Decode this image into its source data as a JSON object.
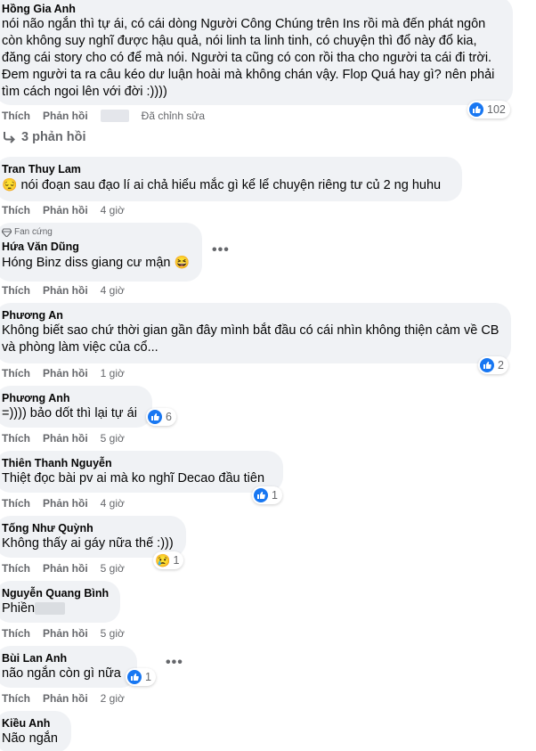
{
  "comments": [
    {
      "name": "Hồng Gia Anh",
      "text": "nói não ngắn thì tự ái, có cái dòng Người Công Chúng trên Ins rồi mà đến phát ngôn còn không suy nghĩ được hậu quả, nói linh ta linh tinh, có chuyện thì đổ này đổ kia, đăng cái story cho có để mà nói. Người ta cũng có con rồi tha cho người ta cái đi trời. Đem người ta ra câu kéo dư luận hoài mà không chán vậy. Flop Quá hay gì? nên phải tìm cách ngoi lên với đời :))))",
      "like": "Thích",
      "reply": "Phản hồi",
      "time": "Đã chỉnh sửa",
      "reaction_count": "102",
      "reaction_icon": "like-icon"
    },
    {
      "name": "Tran Thuy Lam",
      "emoji": "😔",
      "text": "nói đoạn sau đạo lí ai chả hiểu mắc gì kể lể chuyện riêng tư củ 2 ng huhu",
      "like": "Thích",
      "reply": "Phản hồi",
      "time": "4 giờ"
    },
    {
      "badge": "Fan cứng",
      "name": "Hứa Văn Dũng",
      "text": "Hóng Binz diss giang cư mận",
      "emoji": "😆",
      "like": "Thích",
      "reply": "Phản hồi",
      "time": "4 giờ"
    },
    {
      "name": "Phương An",
      "text": "Không biết sao chứ thời gian gần đây mình bắt đầu có cái nhìn không thiện cảm về CB và phòng làm việc của cổ...",
      "like": "Thích",
      "reply": "Phản hồi",
      "time": "1 giờ",
      "reaction_count": "2",
      "reaction_icon": "like-icon"
    },
    {
      "name": "Phương Anh",
      "text": "=)))) bảo dốt thì lại tự ái",
      "like": "Thích",
      "reply": "Phản hồi",
      "time": "5 giờ",
      "reaction_count": "6",
      "reaction_icon": "like-icon"
    },
    {
      "name": "Thiên Thanh Nguyễn",
      "text": "Thiệt đọc bài pv ai mà ko nghĩ Decao đầu tiên",
      "like": "Thích",
      "reply": "Phản hồi",
      "time": "4 giờ",
      "reaction_count": "1",
      "reaction_icon": "like-icon"
    },
    {
      "name": "Tống Như Quỳnh",
      "text": "Không thấy ai gáy nữa thế :)))",
      "like": "Thích",
      "reply": "Phản hồi",
      "time": "5 giờ",
      "reaction_count": "1",
      "reaction_icon": "sad-icon",
      "reaction_emoji": "😢"
    },
    {
      "name": "Nguyễn Quang Bình",
      "text": "Phiền",
      "like": "Thích",
      "reply": "Phản hồi",
      "time": "5 giờ"
    },
    {
      "name": "Bùi Lan Anh",
      "text": "não ngắn còn gì nữa",
      "like": "Thích",
      "reply": "Phản hồi",
      "time": "2 giờ",
      "reaction_count": "1",
      "reaction_icon": "like-icon"
    },
    {
      "name": "Kiều Anh",
      "text": "Não ngắn"
    }
  ],
  "replies_link": "3 phản hồi",
  "more_label": "•••",
  "colors": {
    "bubble": "#f0f2f5",
    "like_blue": "#1877f2",
    "meta": "#65676b"
  }
}
